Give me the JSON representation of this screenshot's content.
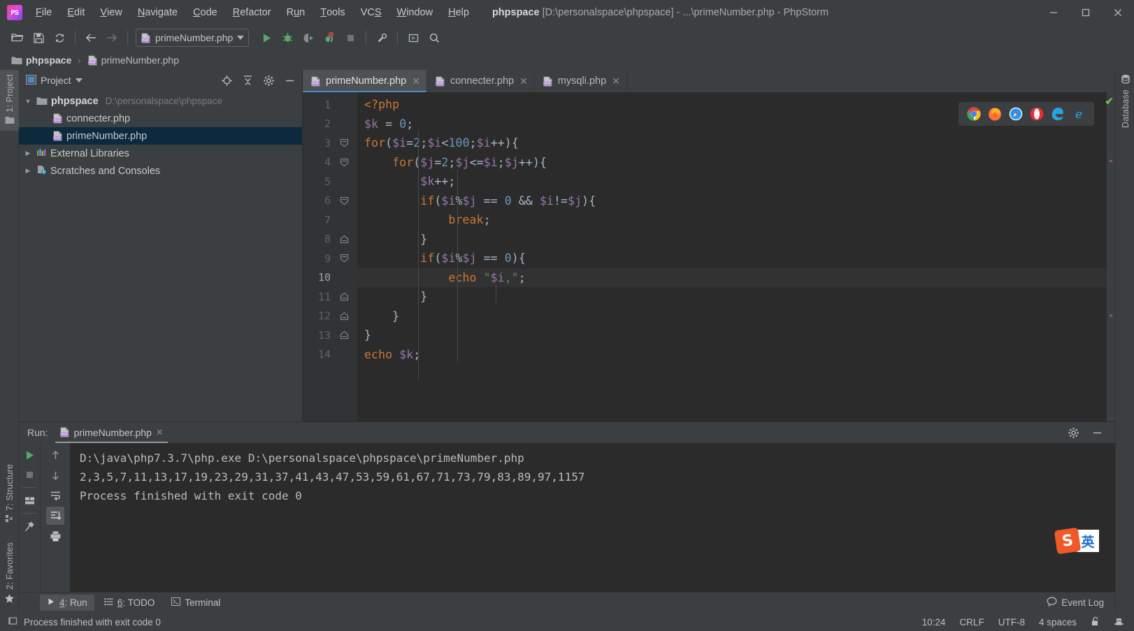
{
  "window": {
    "app_logo": "PS",
    "title_project": "phpspace",
    "title_rest": "[D:\\personalspace\\phpspace] - ...\\primeNumber.php - PhpStorm",
    "controls": {
      "minimize": "—",
      "maximize": "□",
      "close": "✕"
    }
  },
  "menubar": [
    {
      "label": "File",
      "mnemonic": "F"
    },
    {
      "label": "Edit",
      "mnemonic": "E"
    },
    {
      "label": "View",
      "mnemonic": "V"
    },
    {
      "label": "Navigate",
      "mnemonic": "N"
    },
    {
      "label": "Code",
      "mnemonic": "C"
    },
    {
      "label": "Refactor",
      "mnemonic": "R"
    },
    {
      "label": "Run",
      "mnemonic": "u"
    },
    {
      "label": "Tools",
      "mnemonic": "T"
    },
    {
      "label": "VCS",
      "mnemonic": "S"
    },
    {
      "label": "Window",
      "mnemonic": "W"
    },
    {
      "label": "Help",
      "mnemonic": "H"
    }
  ],
  "toolbar": {
    "buttons": [
      {
        "name": "open-folder-icon",
        "title": "Open"
      },
      {
        "name": "save-all-icon",
        "title": "Save All"
      },
      {
        "name": "sync-icon",
        "title": "Synchronize"
      },
      {
        "name": "back-arrow-icon",
        "title": "Back"
      },
      {
        "name": "forward-arrow-icon",
        "title": "Forward"
      }
    ],
    "run_config": "primeNumber.php",
    "run_buttons": [
      {
        "name": "run-icon",
        "title": "Run"
      },
      {
        "name": "debug-icon",
        "title": "Debug"
      },
      {
        "name": "run-with-coverage-icon",
        "title": "Run with Coverage"
      },
      {
        "name": "debug-listen-icon",
        "title": "Stop Listening"
      },
      {
        "name": "stop-icon",
        "title": "Stop"
      },
      {
        "name": "wrench-icon",
        "title": "Settings"
      },
      {
        "name": "run-anything-icon",
        "title": "Run Anything"
      },
      {
        "name": "search-everywhere-icon",
        "title": "Search Everywhere"
      }
    ]
  },
  "breadcrumb": {
    "items": [
      {
        "label": "phpspace",
        "icon": "folder-icon",
        "bold": true
      },
      {
        "label": "primeNumber.php",
        "icon": "php-file-icon",
        "bold": false
      }
    ],
    "separator": "›"
  },
  "left_strip": [
    {
      "label": "1: Project",
      "mnemonic": "1",
      "active": true,
      "icon": "project-icon"
    },
    {
      "label": "7: Structure",
      "mnemonic": "7",
      "active": false,
      "icon": "structure-icon"
    },
    {
      "label": "2: Favorites",
      "mnemonic": "2",
      "active": false,
      "icon": "favorites-star-icon"
    }
  ],
  "right_strip": [
    {
      "label": "Database",
      "active": false,
      "icon": "database-icon"
    }
  ],
  "project_panel": {
    "title": "Project",
    "header_buttons": [
      {
        "name": "locate-target-icon",
        "title": "Select Opened File"
      },
      {
        "name": "collapse-all-icon",
        "title": "Collapse All"
      },
      {
        "name": "gear-icon",
        "title": "Settings"
      },
      {
        "name": "hide-icon",
        "title": "Hide"
      }
    ],
    "tree": [
      {
        "label": "phpspace",
        "sub": "D:\\personalspace\\phpspace",
        "indent": 0,
        "arrow": "down",
        "icon": "folder-icon",
        "bold": true,
        "selected": false
      },
      {
        "label": "connecter.php",
        "sub": "",
        "indent": 1,
        "arrow": "none",
        "icon": "php-file-icon",
        "bold": false,
        "selected": false
      },
      {
        "label": "primeNumber.php",
        "sub": "",
        "indent": 1,
        "arrow": "none",
        "icon": "php-file-icon",
        "bold": false,
        "selected": true
      },
      {
        "label": "External Libraries",
        "sub": "",
        "indent": 0,
        "arrow": "right",
        "icon": "libraries-icon",
        "bold": false,
        "selected": false
      },
      {
        "label": "Scratches and Consoles",
        "sub": "",
        "indent": 0,
        "arrow": "right",
        "icon": "scratches-icon",
        "bold": false,
        "selected": false
      }
    ]
  },
  "editor": {
    "tabs": [
      {
        "label": "primeNumber.php",
        "active": true,
        "icon": "php-file-icon",
        "close": "✕"
      },
      {
        "label": "connecter.php",
        "active": false,
        "icon": "php-file-icon",
        "close": "✕"
      },
      {
        "label": "mysqli.php",
        "active": false,
        "icon": "php-file-icon",
        "close": "✕"
      }
    ],
    "current_line": 10,
    "inspection_status": "✔",
    "browsers": [
      {
        "name": "chrome-icon",
        "title": "Chrome"
      },
      {
        "name": "firefox-icon",
        "title": "Firefox"
      },
      {
        "name": "safari-icon",
        "title": "Safari"
      },
      {
        "name": "opera-icon",
        "title": "Opera"
      },
      {
        "name": "edge-icon",
        "title": "Edge"
      },
      {
        "name": "internet-explorer-icon",
        "title": "Internet Explorer"
      }
    ],
    "lines": [
      {
        "num": 1,
        "fold": "none",
        "indent": 0,
        "text": "<?php"
      },
      {
        "num": 2,
        "fold": "none",
        "indent": 0,
        "text": "$k = 0;"
      },
      {
        "num": 3,
        "fold": "open",
        "indent": 0,
        "text": "for($i=2;$i<100;$i++){"
      },
      {
        "num": 4,
        "fold": "open",
        "indent": 1,
        "text": "for($j=2;$j<=$i;$j++){"
      },
      {
        "num": 5,
        "fold": "none",
        "indent": 2,
        "text": "$k++;"
      },
      {
        "num": 6,
        "fold": "open",
        "indent": 2,
        "text": "if($i%$j == 0 && $i!=$j){"
      },
      {
        "num": 7,
        "fold": "none",
        "indent": 3,
        "text": "break;"
      },
      {
        "num": 8,
        "fold": "close",
        "indent": 2,
        "text": "}"
      },
      {
        "num": 9,
        "fold": "open",
        "indent": 2,
        "text": "if($i%$j == 0){"
      },
      {
        "num": 10,
        "fold": "none",
        "indent": 3,
        "text": "echo \"$i,\";"
      },
      {
        "num": 11,
        "fold": "close",
        "indent": 2,
        "text": "}"
      },
      {
        "num": 12,
        "fold": "close",
        "indent": 1,
        "text": "}"
      },
      {
        "num": 13,
        "fold": "close",
        "indent": 0,
        "text": "}"
      },
      {
        "num": 14,
        "fold": "none",
        "indent": 0,
        "text": "echo $k;"
      }
    ]
  },
  "run_panel": {
    "label": "Run:",
    "tab": "primeNumber.php",
    "tab_close": "✕",
    "header_buttons": [
      {
        "name": "gear-icon",
        "title": "Settings"
      },
      {
        "name": "hide-icon",
        "title": "Hide"
      }
    ],
    "side_buttons": [
      {
        "name": "rerun-icon",
        "title": "Rerun",
        "active": false
      },
      {
        "name": "stop-icon",
        "title": "Stop",
        "active": false
      },
      {
        "name": "layout-icon",
        "title": "Layout Settings",
        "active": false
      },
      {
        "name": "pin-icon",
        "title": "Pin Tab",
        "active": false
      }
    ],
    "side_buttons2": [
      {
        "name": "up-arrow-icon",
        "title": "Up",
        "active": false
      },
      {
        "name": "down-arrow-icon",
        "title": "Down",
        "active": false
      },
      {
        "name": "soft-wrap-icon",
        "title": "Soft-Wrap",
        "active": false
      },
      {
        "name": "scroll-to-end-icon",
        "title": "Scroll to End",
        "active": true
      },
      {
        "name": "print-icon",
        "title": "Print",
        "active": false
      }
    ],
    "console_lines": [
      "D:\\java\\php7.3.7\\php.exe D:\\personalspace\\phpspace\\primeNumber.php",
      "2,3,5,7,11,13,17,19,23,29,31,37,41,43,47,53,59,61,67,71,73,79,83,89,97,1157",
      "Process finished with exit code 0"
    ]
  },
  "bottom_bar": {
    "tabs": [
      {
        "label": "4: Run",
        "mnemonic": "4",
        "icon": "run-icon",
        "active": true
      },
      {
        "label": "6: TODO",
        "mnemonic": "6",
        "icon": "todo-icon",
        "active": false
      },
      {
        "label": "Terminal",
        "mnemonic": "",
        "icon": "terminal-icon",
        "active": false
      }
    ],
    "event_log": "Event Log"
  },
  "status_bar": {
    "message": "Process finished with exit code 0",
    "right_items": [
      "10:24",
      "CRLF",
      "UTF-8",
      "4 spaces"
    ],
    "icons": [
      {
        "name": "lock-icon",
        "title": "Read-only toggle"
      },
      {
        "name": "inspector-hat-icon",
        "title": "Code Inspector"
      }
    ]
  },
  "ime": {
    "logo": "S",
    "mode": "英"
  },
  "colors": {
    "accent_blue": "#4a88c7",
    "selection": "#0d293e",
    "keyword": "#cc7832",
    "variable": "#9876aa",
    "number": "#6897bb",
    "string": "#6a8759",
    "plain": "#a9b7c6",
    "ok_green": "#6bbf4f"
  }
}
